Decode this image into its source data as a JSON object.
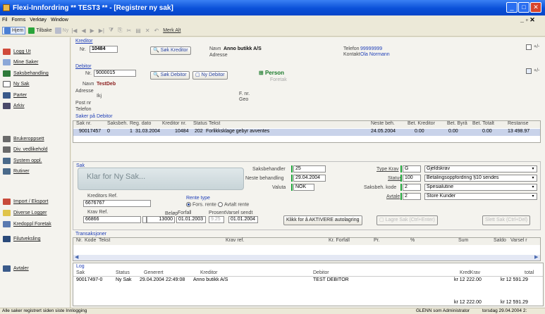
{
  "title": "Flexi-Innfordring ** TEST3 **  - [Registrer ny sak]",
  "window_controls": {
    "minimize": "_",
    "maximize": "□",
    "close": "✕",
    "mdi": "_ ▫ ✕"
  },
  "menu": [
    "Fil",
    "Forms",
    "Verktøy",
    "Window"
  ],
  "toolbar": {
    "home": "Hjem",
    "back": "Tilbake",
    "new": "Ny",
    "mark_all": "Merk Alt"
  },
  "sidebar": [
    "Logg Ut",
    "Mine Saker",
    "Saksbehandling",
    "Ny Sak",
    "Parter",
    "Arkiv",
    "Brukeroppsett",
    "Div. vedlikehold",
    "System oppl.",
    "Rutiner",
    "Import / Eksport",
    "Diverse Logger",
    "Kredoppl Foretak",
    "Filutveksling",
    "Avtaler"
  ],
  "kreditor": {
    "label": "Kreditor",
    "nr_label": "Nr.",
    "nr": "10484",
    "sok_button": "Søk Kreditor",
    "navn_label": "Navn",
    "navn": "Anno butikk A/S",
    "adresse_label": "Adresse",
    "telefon_label": "Telefon",
    "telefon": "99999999",
    "kontakt_label": "Kontakt",
    "kontakt": "Ola Normann",
    "plusminus": "+/-"
  },
  "debitor": {
    "label": "Debitor",
    "nr_label": "Nr.",
    "nr": "9000015",
    "sok_button": "Søk Debitor",
    "ny_button": "Ny Debitor",
    "person_label": "Person",
    "foretak_label": "Foretak",
    "navn_label": "Navn",
    "navn": "TestDeb",
    "adresse_label": "Adresse",
    "adresse": "Ikj",
    "postnr_label": "Post nr",
    "telefon_label": "Telefon",
    "fnr_label": "F. nr.",
    "geo_label": "Geo",
    "plusminus": "+/-"
  },
  "saker_label": "Saker på Debitor",
  "saker_table": {
    "headers": [
      "Sak nr.",
      "Saksbeh.",
      "Reg. dato",
      "Kreditor nr.",
      "Status",
      "Tekst",
      "Neste beh.",
      "Bet. Kreditor",
      "Bet. Byrå",
      "Bet. Totalt",
      "Restanse"
    ],
    "row": [
      "90017457",
      "0",
      "1",
      "31.03.2004",
      "10484",
      "202",
      "Forlikksklage gebyr avventes",
      "24.05.2004",
      "0.00",
      "0.00",
      "0.00",
      "13 498.97"
    ]
  },
  "sak_panel": {
    "label": "Sak",
    "status_text": "Klar for Ny Sak...",
    "saksbehandler_label": "Saksbehandler",
    "saksbehandler": "25",
    "neste_label": "Neste behandling",
    "neste": "29.04.2004",
    "status_label": "Status",
    "status": "100",
    "valuta_label": "Valuta",
    "valuta": "NOK",
    "type_label": "Type Krav",
    "type_code": "G",
    "type_text": "Gjeldskrav",
    "status_text2": "Betalingsoppfordring §10 sendes",
    "saksbeh_kode_label": "Saksbeh. kode",
    "saksbeh_kode": "2",
    "saksbeh_kode_text": "Spesialutine",
    "avtale_label": "Avtale",
    "avtale": "2",
    "avtale_text": "Store Kunder"
  },
  "krav": {
    "kreditors_ref_label": "Kreditors Ref.",
    "kreditors_ref": "6676767",
    "rente_type_label": "Rente type",
    "rente_fors": "Fors. rente",
    "rente_avtalt": "Avtalt rente",
    "krav_ref_label": "Krav Ref.",
    "krav_ref": "66866",
    "belop_label": "Beløp",
    "belop": "13000",
    "forfall_label": "Forfall",
    "forfall": "01.01.2003",
    "prosent_label": "Prosent",
    "prosent": "9.25",
    "varsel_label": "Varsel sendt",
    "varsel": "01.01.2004",
    "activate_button": "Klikk for å AKTIVERE autolagring",
    "lagre_button": "Lagre Sak (Ctrl+Enter)",
    "slett_button": "Slett Sak (Ctrl+Del)"
  },
  "transaksjoner": {
    "label": "Transaksjoner",
    "headers": [
      "Nr.",
      "Kode",
      "Tekst",
      "Krav ref.",
      "Kr. Forfall",
      "Pr.",
      "%",
      "Sum",
      "Saldo",
      "Varsel r"
    ]
  },
  "log": {
    "label": "Log",
    "headers": [
      "Sak",
      "Status",
      "Generert",
      "Kreditor",
      "Debitor",
      "KredKrav",
      "total"
    ],
    "row": [
      "90017497-0",
      "Ny Sak",
      "29.04.2004 22:49:08",
      "Anno butikk A/S",
      "TEST DEBITOR",
      "kr 12 222.00",
      "kr 12 591.29"
    ],
    "sum_kred": "kr 12 222.00",
    "sum_total": "kr 12 591.29"
  },
  "statusbar": {
    "left": "Alle saker registrert siden siste Innlogging",
    "user": "GLENN som Administrator",
    "date": "torsdag 29.04.2004 2:"
  },
  "colors": {
    "titlebar": "#0a4fd8",
    "accent_green": "#1ea43a",
    "selected_row": "#c9d3ea",
    "link": "#2140b8"
  }
}
